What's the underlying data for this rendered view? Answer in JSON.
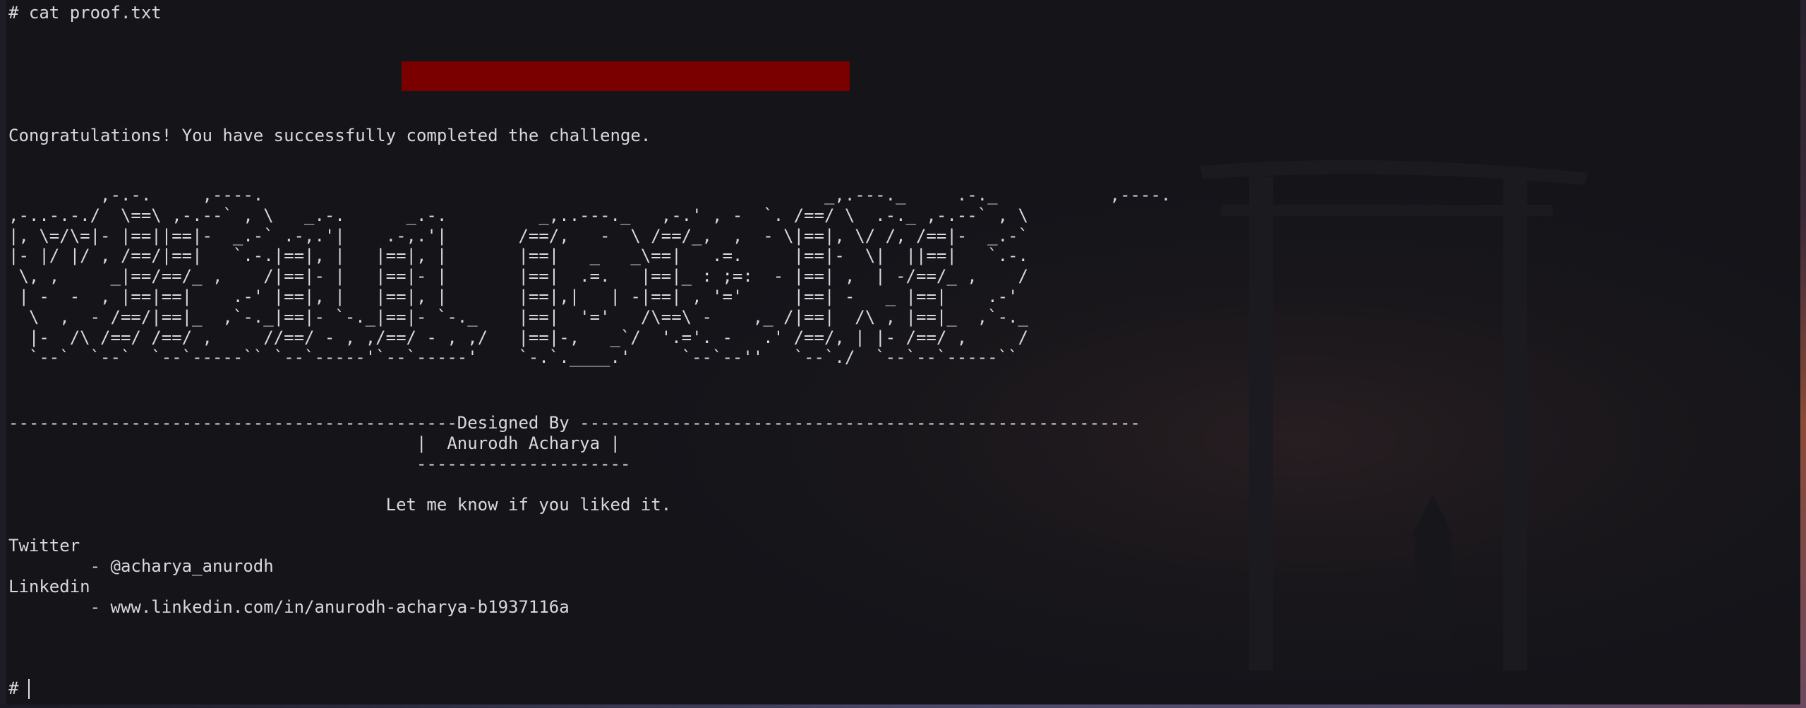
{
  "terminal": {
    "command_line": "# cat proof.txt",
    "congrats_message": "Congratulations! You have successfully completed the challenge.",
    "ascii_art": "         ,-.-.     ,----.                                                       _,.---._     .-._           ,----.  \n,-..-.-./  \\==\\ ,-.--` , \\   _.-.      _.-.         _,..---._   ,-.' , -  `. /==/ \\  .-._ ,-.--` , \\ \n|, \\=/\\=|- |==||==|-  _.-` .-,.'|    .-,.'|       /==/,   -  \\ /==/_,  ,  - \\|==|, \\/ /, /==|-  _.-` \n|- |/ |/ , /==/|==|   `.-.|==|, |   |==|, |       |==|   _   _\\==|   .=.     |==|-  \\|  ||==|   `.-. \n \\, ,     _|==/==/_ ,    /|==|- |   |==|- |       |==|  .=.   |==|_ : ;=:  - |==| ,  | -/==/_ ,    / \n | -  -  , |==|==|    .-' |==|, |   |==|, |       |==|,|   | -|==| , '='     |==| -   _ |==|    .-'  \n  \\  ,  - /==/|==|_  ,`-._|==|- `-._|==|- `-._    |==|  '='   /\\==\\ -    ,_ /|==|  /\\ , |==|_  ,`-._ \n  |-  /\\ /==/ /==/ ,     //==/ - , ,/==/ - , ,/   |==|-,   _`/  '.='. -   .' /==/, | |- /==/ ,     / \n  `--`  `--`  `--`-----`` `--`-----'`--`-----'    `-.`.____.'     `--`--''   `--`./  `--`--`-----``  ",
    "designed_by_rule": "--------------------------------------------Designed By -------------------------------------------------------",
    "author_line": "                                        |  Anurodh Acharya |",
    "author_underline": "                                        ---------------------",
    "liked_message": "                                     Let me know if you liked it.",
    "twitter_label": "Twitter",
    "twitter_handle": "        - @acharya_anurodh",
    "linkedin_label": "Linkedin",
    "linkedin_url": "        - www.linkedin.com/in/anurodh-acharya-b1937116a",
    "prompt": "# "
  },
  "colors": {
    "background": "#141419",
    "text": "#d8d8de",
    "redaction": "#7a0000"
  },
  "icons": {
    "cursor": "text-cursor-icon"
  }
}
